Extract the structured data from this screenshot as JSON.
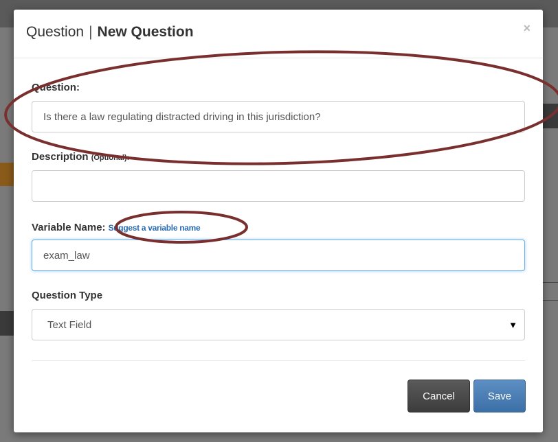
{
  "dialog": {
    "title_prefix": "Question",
    "title_separator": "|",
    "title_main": "New Question",
    "close_glyph": "×"
  },
  "form": {
    "question": {
      "label": "Question:",
      "value": "Is there a law regulating distracted driving in this jurisdiction?"
    },
    "description": {
      "label": "Description",
      "optional_tag": "(Optional):",
      "value": ""
    },
    "variable_name": {
      "label": "Variable Name:",
      "suggest_link": "Suggest a variable name",
      "value": "exam_law"
    },
    "question_type": {
      "label": "Question Type",
      "selected": "Text Field",
      "caret_glyph": "▼"
    }
  },
  "buttons": {
    "cancel": "Cancel",
    "save": "Save"
  },
  "colors": {
    "annotation": "#7a2f2f",
    "link": "#2a6ab1",
    "save": "#3c6fa6",
    "cancel": "#444444",
    "focus": "#66afe9"
  },
  "icons": {
    "close": "close-icon",
    "select_caret": "chevron-down-icon"
  }
}
